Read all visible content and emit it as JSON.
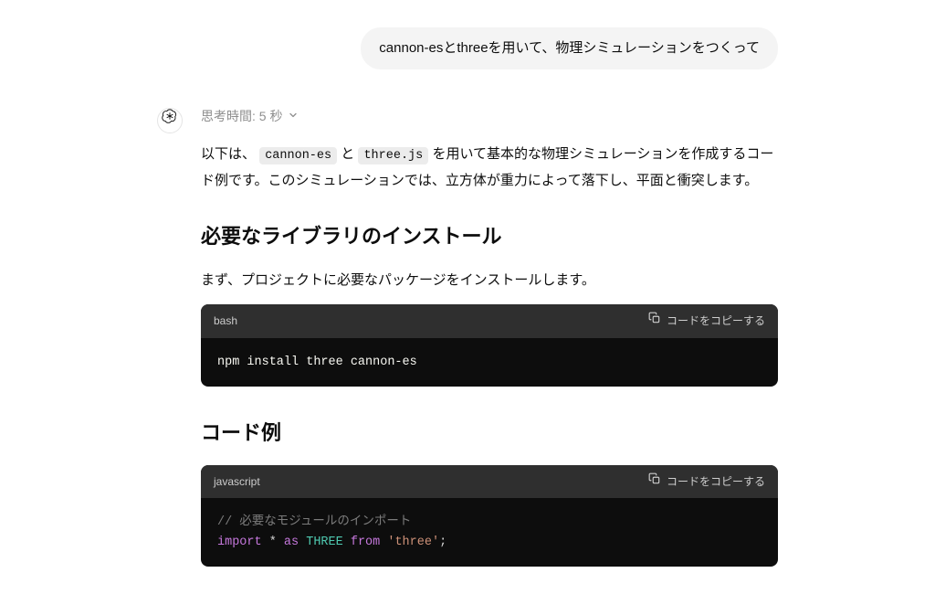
{
  "user": {
    "message": "cannon-esとthreeを用いて、物理シミュレーションをつくって"
  },
  "assistant": {
    "thought_label": "思考時間: 5 秒",
    "intro_pre": "以下は、",
    "intro_code1": "cannon-es",
    "intro_mid1": " と ",
    "intro_code2": "three.js",
    "intro_post": " を用いて基本的な物理シミュレーションを作成するコード例です。このシミュレーションでは、立方体が重力によって落下し、平面と衝突します。",
    "section1_heading": "必要なライブラリのインストール",
    "section1_sub": "まず、プロジェクトに必要なパッケージをインストールします。",
    "section2_heading": "コード例",
    "code1": {
      "lang": "bash",
      "copy_label": "コードをコピーする",
      "content": "npm install three cannon-es"
    },
    "code2": {
      "lang": "javascript",
      "copy_label": "コードをコピーする",
      "line1_comment": "// 必要なモジュールのインポート",
      "line2_kw_import": "import",
      "line2_star": " * ",
      "line2_kw_as": "as",
      "line2_ident": " THREE ",
      "line2_kw_from": "from",
      "line2_space": " ",
      "line2_str": "'three'",
      "line2_semi": ";"
    }
  }
}
